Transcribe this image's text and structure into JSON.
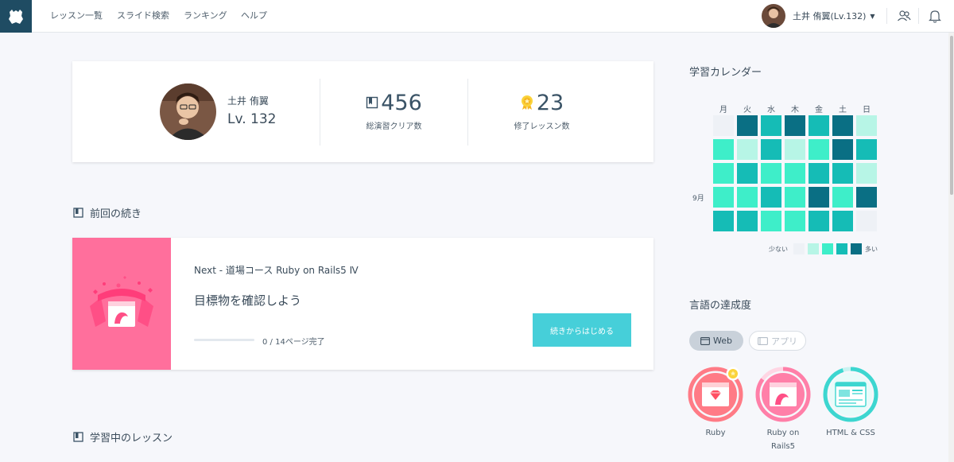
{
  "nav": {
    "items": [
      {
        "label": "レッスン一覧"
      },
      {
        "label": "スライド検索"
      },
      {
        "label": "ランキング"
      },
      {
        "label": "ヘルプ"
      }
    ],
    "user_name": "土井 侑翼(Lv.132)"
  },
  "profile": {
    "name": "土井 侑翼",
    "level": "Lv. 132",
    "cleared_count": "456",
    "cleared_label": "総演習クリア数",
    "completed_count": "23",
    "completed_label": "修了レッスン数"
  },
  "continue_section": {
    "title": "前回の続き",
    "course": "Next - 道場コース Ruby on Rails5 Ⅳ",
    "lesson": "目標物を確認しよう",
    "progress_text": "0 / 14ページ完了",
    "progress_fraction": 0,
    "button_label": "続きからはじめる"
  },
  "learning_section": {
    "title": "学習中のレッスン"
  },
  "calendar": {
    "title": "学習カレンダー",
    "days": [
      "月",
      "火",
      "水",
      "木",
      "金",
      "土",
      "日"
    ],
    "month_label": "9月",
    "legend_less": "少ない",
    "legend_more": "多い",
    "level_colors": [
      "#eef1f6",
      "#b7f5e6",
      "#3eeec9",
      "#15bcb6",
      "#0a6f84"
    ],
    "levels": [
      [
        0,
        4,
        3,
        4,
        3,
        4,
        1
      ],
      [
        2,
        1,
        3,
        1,
        2,
        4,
        3
      ],
      [
        2,
        3,
        2,
        2,
        3,
        3,
        1
      ],
      [
        2,
        2,
        3,
        2,
        4,
        2,
        4
      ],
      [
        3,
        3,
        2,
        2,
        3,
        3,
        0
      ]
    ]
  },
  "achievement": {
    "title": "言語の達成度",
    "tab_web": "Web",
    "tab_app": "アプリ",
    "languages": [
      {
        "label_line1": "Ruby",
        "label_line2": "",
        "progress": 1.0,
        "color": "#ff7b86"
      },
      {
        "label_line1": "Ruby on",
        "label_line2": "Rails5",
        "progress": 0.85,
        "color": "#ff7fa8"
      },
      {
        "label_line1": "HTML & CSS",
        "label_line2": "",
        "progress": 0.95,
        "color": "#3dd6d0"
      }
    ]
  }
}
